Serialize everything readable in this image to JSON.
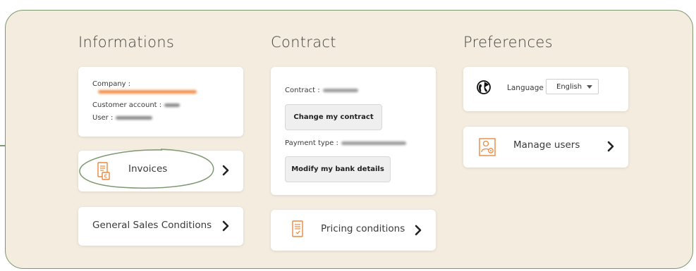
{
  "sections": {
    "informations": "Informations",
    "contract": "Contract",
    "preferences": "Preferences"
  },
  "account": {
    "company_label": "Company :",
    "customer_account_label": "Customer account :",
    "user_label": "User :"
  },
  "contract": {
    "contract_label": "Contract :",
    "change_button": "Change my contract",
    "payment_type_label": "Payment type :",
    "modify_bank_button": "Modify my bank details"
  },
  "links": {
    "invoices": "Invoices",
    "general_sales": "General Sales Conditions",
    "pricing": "Pricing conditions",
    "manage_users": "Manage users"
  },
  "language": {
    "label": "Language",
    "selected": "English"
  },
  "colors": {
    "accent_orange": "#e8893f",
    "panel_bg": "#f4ecdf",
    "border_green": "#7d9970"
  }
}
